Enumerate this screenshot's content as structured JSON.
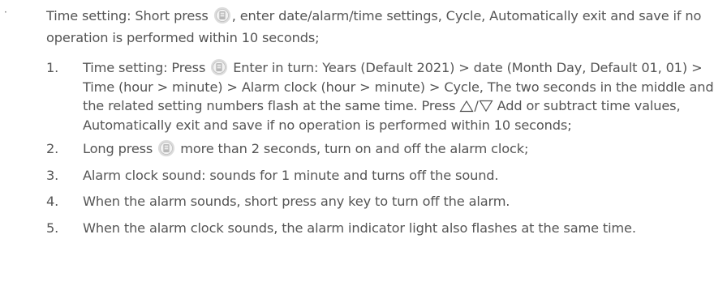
{
  "intro": {
    "bullet": "·",
    "before_icon": "Time setting: Short press ",
    "after_icon": ", enter date/alarm/time settings, Cycle, Automatically exit and save if no operation is performed within 10 seconds;"
  },
  "steps": [
    {
      "num": "1.",
      "before_icon": "Time setting: Press ",
      "after_icon": " Enter in turn: Years (Default 2021) > date (Month Day, Default 01, 01) > Time (hour > minute) > Alarm clock (hour > minute) > Cycle, The two seconds in the middle and the related setting numbers flash at the same time. Press ",
      "arrow_sep": "/",
      "after_arrows": " Add or subtract time values, Automatically exit and save if no operation is performed within 10 seconds;"
    },
    {
      "num": "2.",
      "before_icon": "Long press ",
      "after_icon": " more than 2 seconds, turn on and off the alarm clock;"
    },
    {
      "num": "3.",
      "text": "Alarm clock sound: sounds for 1 minute and turns off the sound."
    },
    {
      "num": "4.",
      "text": "When the alarm sounds, short press any key to turn off the alarm."
    },
    {
      "num": "5.",
      "text": "When the alarm clock sounds, the alarm indicator light also flashes at the same time."
    }
  ],
  "icons": {
    "button": "round-button-icon",
    "up": "up-triangle-icon",
    "down": "down-triangle-icon"
  }
}
